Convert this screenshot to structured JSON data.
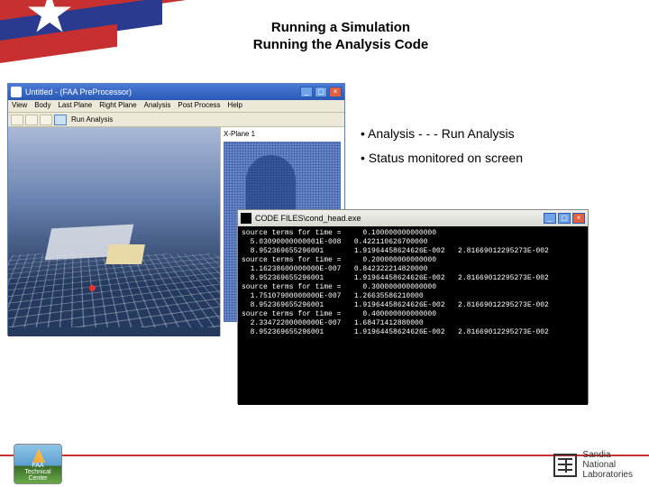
{
  "banner": {},
  "title": {
    "line1": "Running a Simulation",
    "line2": "Running the Analysis Code"
  },
  "bullets": {
    "item1": "Analysis - - - Run Analysis",
    "item2": "Status monitored on screen"
  },
  "app": {
    "title": "Untitled - (FAA PreProcessor)",
    "menu": {
      "m0": "View",
      "m1": "Body",
      "m2": "Last Plane",
      "m3": "Right Plane",
      "m4": "Analysis",
      "m5": "Post Process",
      "m6": "Help"
    },
    "toolbar_text": "Run Analysis",
    "panel_title": "X-Plane 1"
  },
  "console": {
    "title": "CODE FILES\\cond_head.exe",
    "text": "source terms for time =     0.100000000000000\n  5.03090000000001E-008   0.422110626700000\n  8.952369655296001       1.91964458624626E-002   2.81669012295273E-002\nsource terms for time =     0.200000000000000\n  1.16238600000000E-007   0.842322214820000\n  8.952369655296001       1.91964458624626E-002   2.81669012295273E-002\nsource terms for time =     0.300000000000000\n  1.75107900000000E-007   1.26635586210000\n  8.952369655296001       1.91964458624626E-002   2.81669012295273E-002\nsource terms for time =     0.400000000000000\n  2.33472200000000E-007   1.68471412880000\n  8.952369655296001       1.91964458624626E-002   2.81669012295273E-002\n"
  },
  "logos": {
    "faa_l1": "FAA",
    "faa_l2": "Technical",
    "faa_l3": "Center",
    "sandia_l1": "Sandia",
    "sandia_l2": "National",
    "sandia_l3": "Laboratories"
  }
}
